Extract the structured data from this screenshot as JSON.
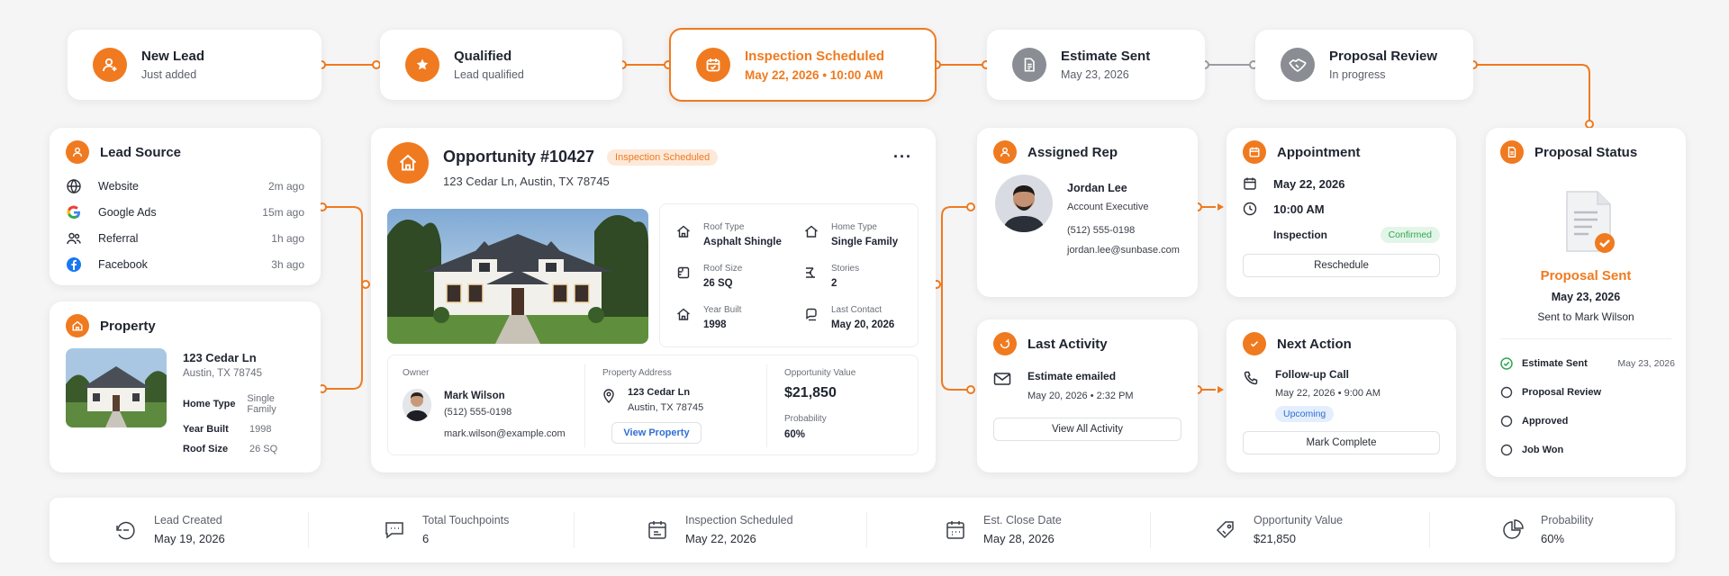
{
  "colors": {
    "accent": "#f07a1f",
    "accent_soft": "#fde9d9",
    "success": "#2fa84f",
    "success_soft": "#e3f5e8",
    "link": "#2f6fd6",
    "link_soft": "#e4eefc",
    "inactive": "#8a8d93"
  },
  "pipeline": [
    {
      "title": "New Lead",
      "sub": "Just added",
      "icon": "user-plus-icon"
    },
    {
      "title": "Qualified",
      "sub": "Lead qualified",
      "icon": "star-badge-icon"
    },
    {
      "title": "Inspection Scheduled",
      "sub": "May 22, 2026  •  10:00 AM",
      "icon": "calendar-icon"
    },
    {
      "title": "Estimate Sent",
      "sub": "May 23, 2026",
      "icon": "document-icon"
    },
    {
      "title": "Proposal Review",
      "sub": "In progress",
      "icon": "handshake-icon"
    }
  ],
  "lead_source": {
    "title": "Lead Source",
    "items": [
      {
        "label": "Website",
        "time": "2m ago",
        "icon": "globe-icon"
      },
      {
        "label": "Google Ads",
        "time": "15m ago",
        "icon": "google-icon"
      },
      {
        "label": "Referral",
        "time": "1h ago",
        "icon": "people-icon"
      },
      {
        "label": "Facebook",
        "time": "3h ago",
        "icon": "facebook-icon"
      }
    ]
  },
  "property": {
    "title": "Property",
    "street": "123 Cedar Ln",
    "city": "Austin, TX 78745",
    "rows": [
      {
        "label": "Home Type",
        "value": "Single Family"
      },
      {
        "label": "Year Built",
        "value": "1998"
      },
      {
        "label": "Roof Size",
        "value": "26 SQ"
      }
    ]
  },
  "opportunity": {
    "title": "Opportunity #10427",
    "status": "Inspection Scheduled",
    "address": "123 Cedar Ln, Austin, TX 78745",
    "more": "···",
    "specs": [
      {
        "label": "Roof Type",
        "value": "Asphalt Shingle",
        "icon": "roof-icon"
      },
      {
        "label": "Home Type",
        "value": "Single Family",
        "icon": "home-icon"
      },
      {
        "label": "Roof Size",
        "value": "26 SQ",
        "icon": "ruler-icon"
      },
      {
        "label": "Stories",
        "value": "2",
        "icon": "stairs-icon"
      },
      {
        "label": "Year Built",
        "value": "1998",
        "icon": "home-icon"
      },
      {
        "label": "Last Contact",
        "value": "May 20, 2026",
        "icon": "chat-icon"
      }
    ],
    "owner": {
      "label": "Owner",
      "name": "Mark Wilson",
      "phone": "(512) 555-0198",
      "email": "mark.wilson@example.com"
    },
    "prop_address": {
      "label": "Property Address",
      "street": "123 Cedar Ln",
      "city": "Austin, TX 78745",
      "button": "View Property"
    },
    "value": {
      "label": "Opportunity Value",
      "amount": "$21,850",
      "prob_label": "Probability",
      "prob": "60%"
    }
  },
  "assigned_rep": {
    "title": "Assigned Rep",
    "name": "Jordan Lee",
    "role": "Account Executive",
    "phone": "(512) 555-0198",
    "email": "jordan.lee@sunbase.com"
  },
  "appointment": {
    "title": "Appointment",
    "date": "May 22, 2026",
    "time": "10:00 AM",
    "type": "Inspection",
    "status": "Confirmed",
    "button": "Reschedule"
  },
  "last_activity": {
    "title": "Last Activity",
    "what": "Estimate emailed",
    "when": "May 20, 2026  •  2:32 PM",
    "button": "View All Activity"
  },
  "next_action": {
    "title": "Next Action",
    "what": "Follow-up Call",
    "when": "May 22, 2026  •  9:00 AM",
    "badge": "Upcoming",
    "button": "Mark Complete"
  },
  "proposal_status": {
    "title": "Proposal Status",
    "state": "Proposal Sent",
    "date": "May 23, 2026",
    "to": "Sent to Mark Wilson",
    "steps": [
      {
        "label": "Estimate Sent",
        "date": "May 23, 2026",
        "done": true
      },
      {
        "label": "Proposal Review",
        "date": "",
        "done": false
      },
      {
        "label": "Approved",
        "date": "",
        "done": false
      },
      {
        "label": "Job Won",
        "date": "",
        "done": false
      }
    ]
  },
  "stats": [
    {
      "label": "Lead Created",
      "value": "May 19, 2026",
      "icon": "refresh-chat-icon"
    },
    {
      "label": "Total Touchpoints",
      "value": "6",
      "icon": "message-icon"
    },
    {
      "label": "Inspection Scheduled",
      "value": "May 22, 2026",
      "icon": "calendar-check-icon"
    },
    {
      "label": "Est. Close Date",
      "value": "May 28, 2026",
      "icon": "calendar-icon"
    },
    {
      "label": "Opportunity Value",
      "value": "$21,850",
      "icon": "tag-icon"
    },
    {
      "label": "Probability",
      "value": "60%",
      "icon": "pie-icon"
    }
  ]
}
